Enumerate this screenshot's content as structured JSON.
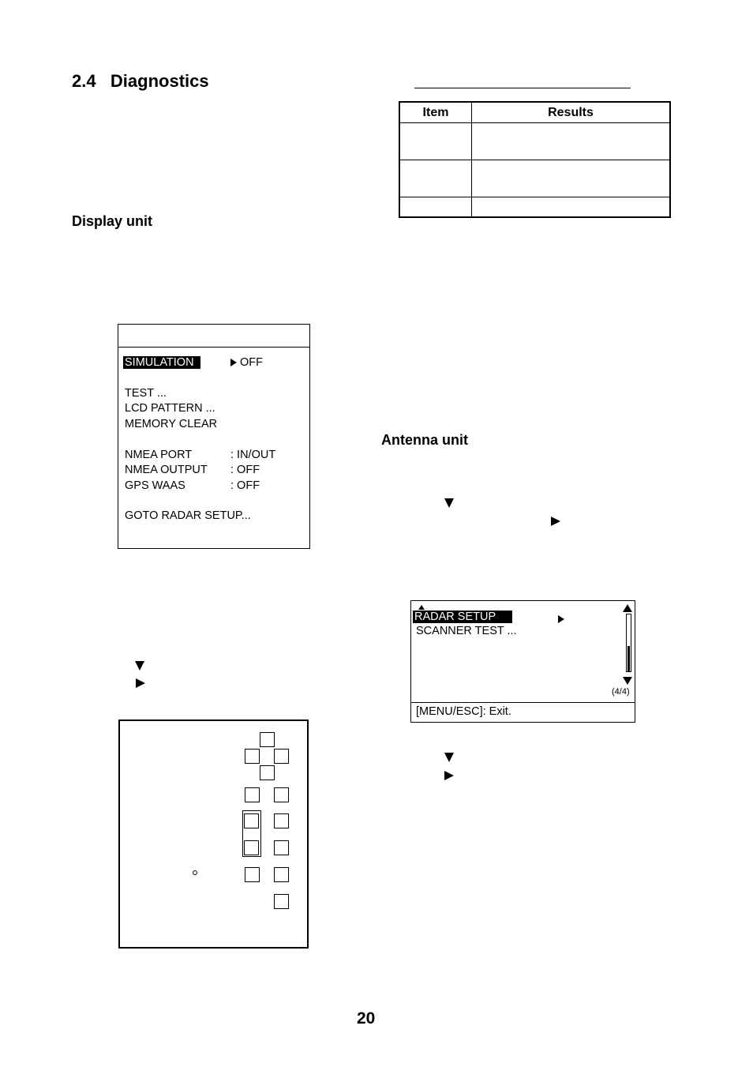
{
  "section": {
    "number": "2.4",
    "title": "Diagnostics",
    "heading": "2.4   Diagnostics"
  },
  "subheadings": {
    "display_unit": "Display unit",
    "antenna_unit": "Antenna unit"
  },
  "results_table": {
    "columns": [
      "Item",
      "Results"
    ],
    "rows": [
      {
        "item": "",
        "result": ""
      },
      {
        "item": "",
        "result": ""
      },
      {
        "item": "",
        "result": ""
      }
    ]
  },
  "menu_display_unit": {
    "title": "",
    "selected_item": "SIMULATION",
    "selected_value": "OFF",
    "items": [
      {
        "label": "SIMULATION",
        "value": "OFF",
        "highlighted": true
      },
      {
        "label": "TEST ...",
        "value": ""
      },
      {
        "label": "LCD PATTERN ...",
        "value": ""
      },
      {
        "label": "MEMORY CLEAR",
        "value": ""
      },
      {
        "label": "NMEA PORT",
        "value": ": IN/OUT"
      },
      {
        "label": "NMEA OUTPUT",
        "value": ": OFF"
      },
      {
        "label": "GPS WAAS",
        "value": ": OFF"
      },
      {
        "label": "GOTO RADAR SETUP...",
        "value": ""
      }
    ]
  },
  "menu_antenna_unit": {
    "items": [
      {
        "label": "RADAR SETUP",
        "highlighted": true
      },
      {
        "label": "SCANNER TEST ...",
        "highlighted": false
      }
    ],
    "page_indicator": "(4/4)",
    "scroll_position_fraction": 0.45,
    "footer": "[MENU/ESC]: Exit."
  },
  "instruction_icons": {
    "down": "down-triangle-icon",
    "right": "right-triangle-icon"
  },
  "control_panel": {
    "keys": 14
  },
  "page_number": "20"
}
